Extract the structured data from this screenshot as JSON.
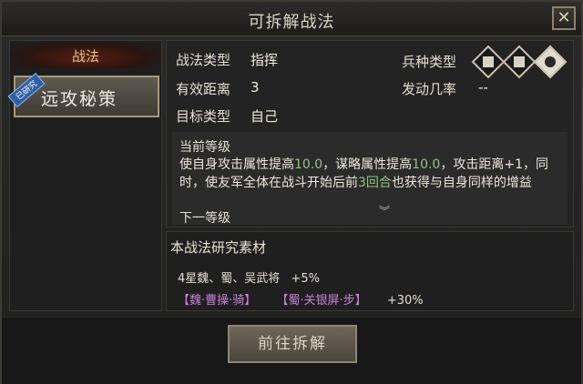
{
  "window": {
    "title": "可拆解战法",
    "close_label": "✕"
  },
  "left": {
    "header": "战法",
    "items": [
      {
        "label": "远攻秘策",
        "badge": "已研究"
      }
    ]
  },
  "info": {
    "tactic_type_label": "战法类型",
    "tactic_type_value": "指挥",
    "range_label": "有效距离",
    "range_value": "3",
    "target_label": "目标类型",
    "target_value": "自己",
    "troop_label": "兵种类型",
    "troop_icons": [
      "infantry-icon",
      "archer-icon",
      "cavalry-icon"
    ],
    "rate_label": "发动几率",
    "rate_value": "--"
  },
  "description": {
    "current_title": "当前等级",
    "text_1": "使自身攻击属性提高",
    "value_1": "10.0",
    "text_2": "，谋略属性提高",
    "value_2": "10.0",
    "text_3": "，攻击距离+1，同时，使友军全体在战斗开始后前",
    "value_3": "3回合",
    "text_4": "也获得与自身同样的增益",
    "next_title": "下一等级",
    "expand_icon": "︾"
  },
  "materials": {
    "title": "本战法研究素材",
    "line1_text": "4星魏、蜀、吴武将",
    "line1_bonus": "+5%",
    "general_1": "【魏·曹操·骑】",
    "general_2": "【蜀·关银屏·步】",
    "line2_bonus": "+30%"
  },
  "actions": {
    "go_dismantle": "前往拆解"
  },
  "colors": {
    "highlight": "#8cc77c",
    "general_tag": "#c982d8"
  }
}
